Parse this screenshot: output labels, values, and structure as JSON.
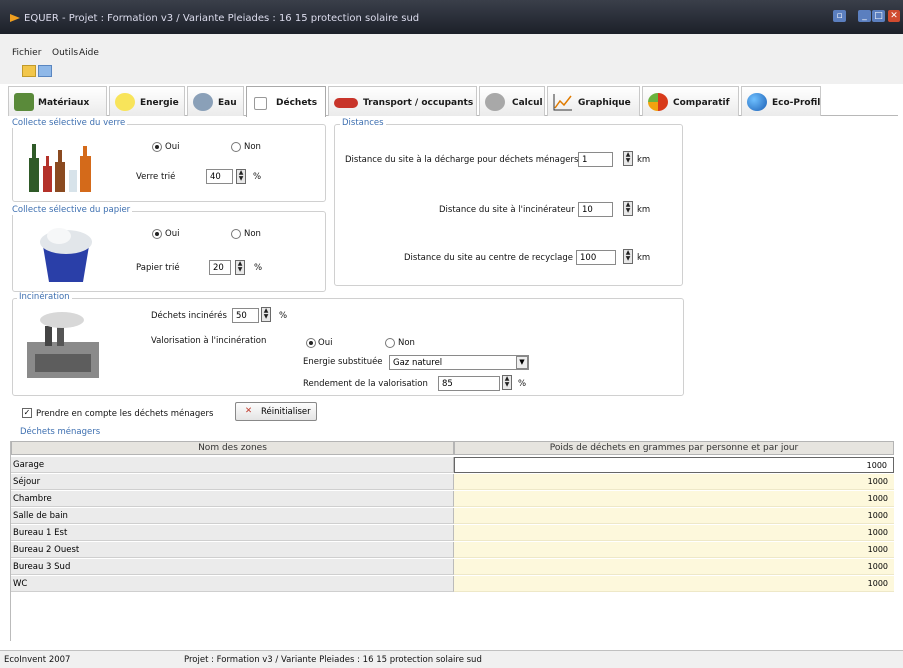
{
  "window": {
    "title": "EQUER - Projet : Formation v3 / Variante Pleiades : 16 15 protection solaire sud"
  },
  "menu": {
    "file": "Fichier",
    "tools": "Outils",
    "help": "Aide"
  },
  "tabs": [
    {
      "label": "Matériaux",
      "icon": "materials-icon"
    },
    {
      "label": "Energie",
      "icon": "lightbulb-icon"
    },
    {
      "label": "Eau",
      "icon": "faucet-icon"
    },
    {
      "label": "Déchets",
      "icon": "recycle-icon"
    },
    {
      "label": "Transport / occupants",
      "icon": "car-icon"
    },
    {
      "label": "Calcul",
      "icon": "gears-icon"
    },
    {
      "label": "Graphique",
      "icon": "chart-icon"
    },
    {
      "label": "Comparatif",
      "icon": "comparison-icon"
    },
    {
      "label": "Eco-Profil",
      "icon": "globe-icon"
    }
  ],
  "active_tab": "Déchets",
  "glass": {
    "legend": "Collecte sélective du verre",
    "yes": "Oui",
    "no": "Non",
    "selected": "Oui",
    "sorted_label": "Verre trié",
    "sorted_value": "40",
    "unit": "%"
  },
  "paper": {
    "legend": "Collecte sélective du papier",
    "yes": "Oui",
    "no": "Non",
    "selected": "Oui",
    "sorted_label": "Papier trié",
    "sorted_value": "20",
    "unit": "%"
  },
  "distances": {
    "legend": "Distances",
    "landfill_label": "Distance du site à la décharge pour déchets ménagers",
    "landfill_value": "1",
    "incinerator_label": "Distance du site à l'incinérateur",
    "incinerator_value": "10",
    "recycling_label": "Distance du site au centre de recyclage",
    "recycling_value": "100",
    "unit": "km"
  },
  "incineration": {
    "legend": "Incinération",
    "burned_label": "Déchets incinérés",
    "burned_value": "50",
    "burned_unit": "%",
    "valorisation_label": "Valorisation à l'incinération",
    "yes": "Oui",
    "no": "Non",
    "selected": "Oui",
    "energy_label": "Energie substituée",
    "energy_value": "Gaz naturel",
    "yield_label": "Rendement de la valorisation",
    "yield_value": "85",
    "yield_unit": "%"
  },
  "household": {
    "checkbox_label": "Prendre en compte les déchets ménagers",
    "checked": true,
    "reset_label": "Réinitialiser",
    "section_label": "Déchets ménagers"
  },
  "table": {
    "columns": [
      "Nom des zones",
      "Poids de déchets en grammes par personne et par jour"
    ],
    "rows": [
      [
        "Garage",
        "1000"
      ],
      [
        "Séjour",
        "1000"
      ],
      [
        "Chambre",
        "1000"
      ],
      [
        "Salle de bain",
        "1000"
      ],
      [
        "Bureau 1 Est",
        "1000"
      ],
      [
        "Bureau 2 Ouest",
        "1000"
      ],
      [
        "Bureau 3 Sud",
        "1000"
      ],
      [
        "WC",
        "1000"
      ]
    ]
  },
  "status": {
    "left": "EcoInvent 2007",
    "project": "Projet : Formation v3 / Variante Pleiades : 16 15 protection solaire sud"
  }
}
